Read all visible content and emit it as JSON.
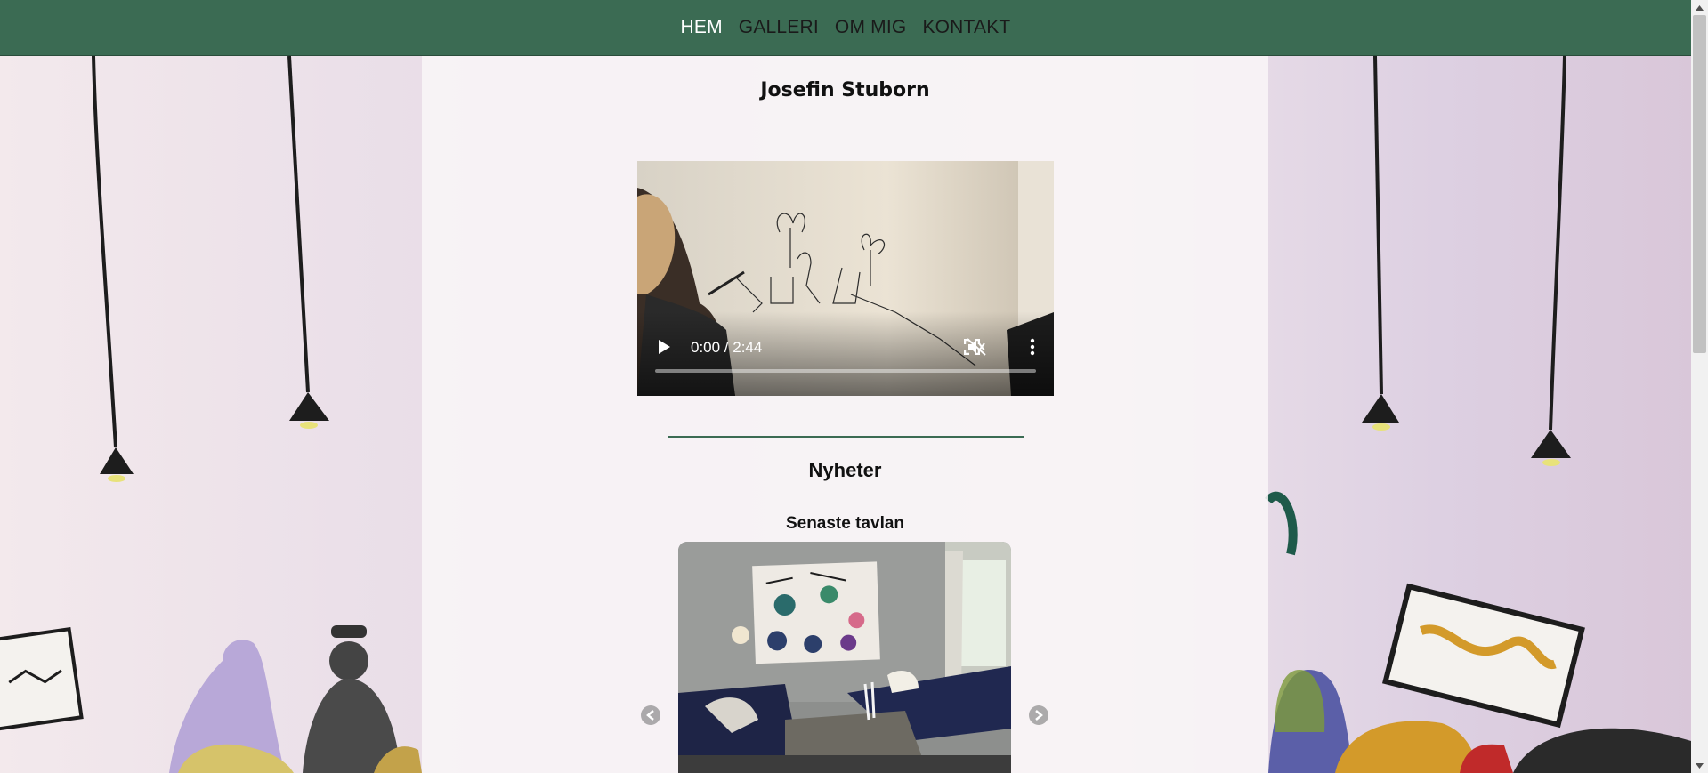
{
  "nav": {
    "items": [
      {
        "label": "HEM",
        "active": true
      },
      {
        "label": "GALLERI",
        "active": false
      },
      {
        "label": "OM MIG",
        "active": false
      },
      {
        "label": "KONTAKT",
        "active": false
      }
    ],
    "background_color": "#3b6b53",
    "active_color": "#ffffff"
  },
  "site": {
    "title": "Josefin Stuborn"
  },
  "video": {
    "time": "0:00 / 2:44",
    "muted": true,
    "icons": [
      "play-icon",
      "muted-speaker-icon",
      "fullscreen-icon",
      "more-options-icon"
    ]
  },
  "news": {
    "heading": "Nyheter",
    "subheading": "Senaste tavlan",
    "icons": [
      "chevron-left-icon",
      "chevron-right-icon"
    ]
  },
  "colors": {
    "accent": "#3b6b53"
  }
}
